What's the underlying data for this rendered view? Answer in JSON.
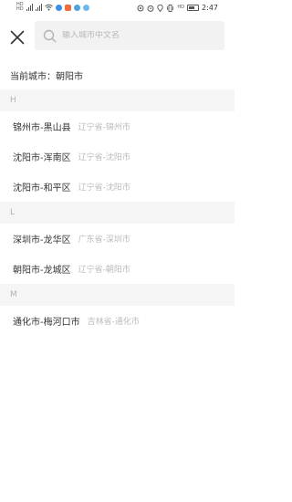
{
  "status_bar": {
    "left_label_1": "HD",
    "left_label_2": "HD",
    "right_label": "HD",
    "time": "2:47",
    "battery": "86"
  },
  "search": {
    "placeholder": "输入城市中文名",
    "value": ""
  },
  "current_city": {
    "text": "当前城市：朝阳市"
  },
  "groups": [
    {
      "letter": "H",
      "cities": [
        {
          "name": "锦州市-黑山县",
          "path": "辽宁省-锦州市"
        },
        {
          "name": "沈阳市-浑南区",
          "path": "辽宁省-沈阳市"
        },
        {
          "name": "沈阳市-和平区",
          "path": "辽宁省-沈阳市"
        }
      ]
    },
    {
      "letter": "L",
      "cities": [
        {
          "name": "深圳市-龙华区",
          "path": "广东省-深圳市"
        },
        {
          "name": "朝阳市-龙城区",
          "path": "辽宁省-朝阳市"
        }
      ]
    },
    {
      "letter": "M",
      "cities": [
        {
          "name": "通化市-梅河口市",
          "path": "吉林省-通化市"
        }
      ]
    }
  ],
  "colors": {
    "group_bg": "#f5f5f5",
    "path_text": "#bbbbbb",
    "primary_text": "#333333"
  }
}
